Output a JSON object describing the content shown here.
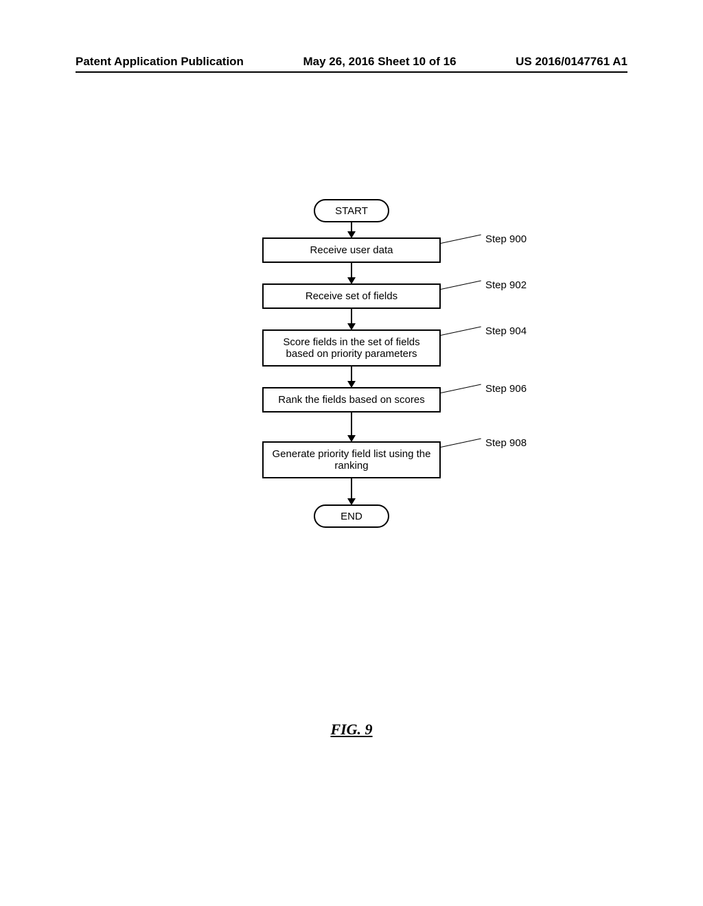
{
  "header": {
    "left": "Patent Application Publication",
    "center": "May 26, 2016  Sheet 10 of 16",
    "right": "US 2016/0147761 A1"
  },
  "flowchart": {
    "start": "START",
    "end": "END",
    "steps": [
      {
        "text": "Receive user data",
        "label": "Step 900"
      },
      {
        "text": "Receive set of fields",
        "label": "Step 902"
      },
      {
        "text": "Score fields in the set of fields based on priority parameters",
        "label": "Step 904"
      },
      {
        "text": "Rank the fields based on scores",
        "label": "Step 906"
      },
      {
        "text": "Generate priority field list using the ranking",
        "label": "Step 908"
      }
    ]
  },
  "figure_label": "FIG. 9"
}
